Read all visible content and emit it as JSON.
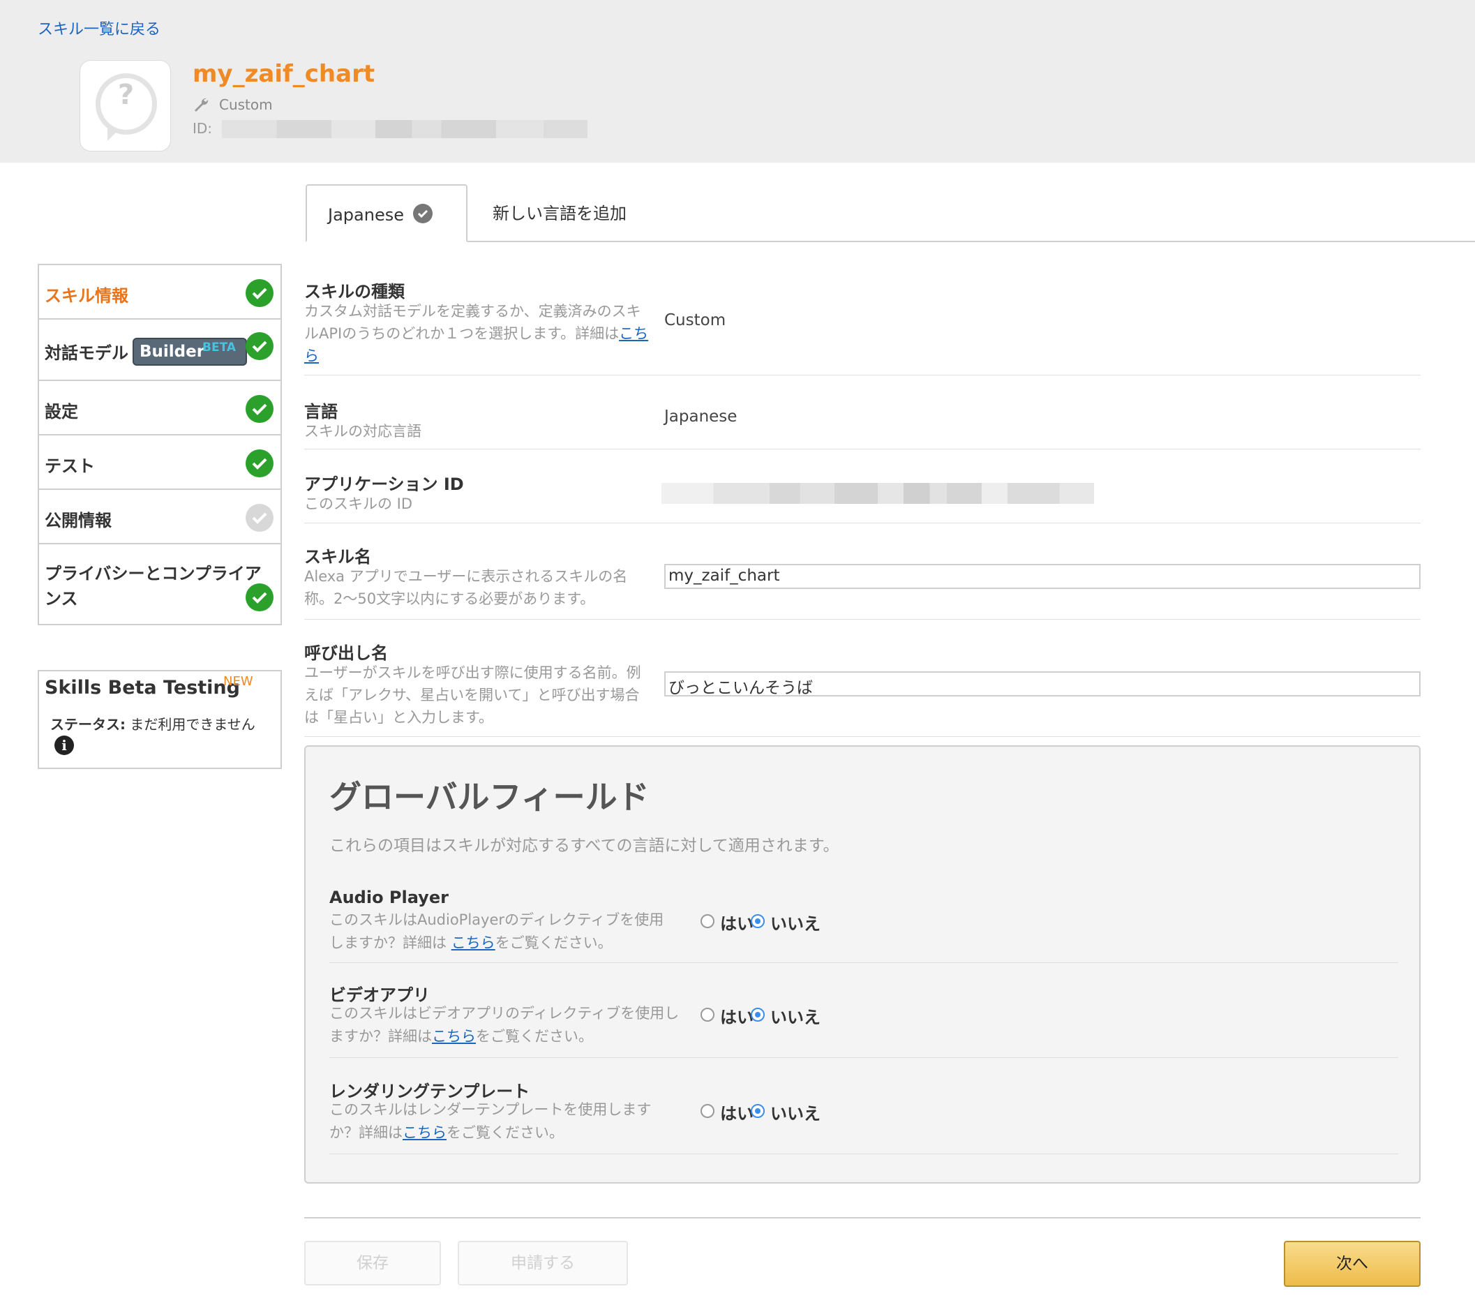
{
  "header": {
    "back_link": "スキル一覧に戻る",
    "skill_title": "my_zaif_chart",
    "skill_type": "Custom",
    "id_label": "ID:",
    "icon_glyph": "?"
  },
  "tabs": {
    "active_label": "Japanese",
    "add_label": "新しい言語を追加"
  },
  "sidebar": {
    "items": [
      {
        "label": "スキル情報",
        "status": "complete",
        "active": true
      },
      {
        "label": "対話モデル",
        "status": "complete",
        "badge": "Builder",
        "badge_sup": "BETA"
      },
      {
        "label": "設定",
        "status": "complete"
      },
      {
        "label": "テスト",
        "status": "complete"
      },
      {
        "label": "公開情報",
        "status": "incomplete"
      },
      {
        "label_line1": "プライバシーとコンプライア",
        "label_line2": "ンス",
        "status": "complete"
      }
    ],
    "beta_testing": {
      "title": "Skills Beta Testing",
      "new_badge": "NEW",
      "status_label": "ステータス:",
      "status_value": " まだ利用できません",
      "info_glyph": "i"
    }
  },
  "form": {
    "skill_type": {
      "title": "スキルの種類",
      "desc_part1": "カスタム対話モデルを定義するか、定義済みのスキルAPIのうちのどれか１つを選択します。詳細は",
      "desc_link": "こちら",
      "value": "Custom"
    },
    "language": {
      "title": "言語",
      "desc": "スキルの対応言語",
      "value": "Japanese"
    },
    "application_id": {
      "title": "アプリケーション ID",
      "desc": "このスキルの ID"
    },
    "skill_name": {
      "title": "スキル名",
      "desc": "Alexa アプリでユーザーに表示されるスキルの名称。2〜50文字以内にする必要があります。",
      "value": "my_zaif_chart"
    },
    "invocation_name": {
      "title": "呼び出し名",
      "desc": "ユーザーがスキルを呼び出す際に使用する名前。例えば「アレクサ、星占いを開いて」と呼び出す場合は「星占い」と入力します。",
      "value": "びっとこいんそうば"
    }
  },
  "global_fields": {
    "title": "グローバルフィールド",
    "desc": "これらの項目はスキルが対応するすべての言語に対して適用されます。",
    "yes_label": "はい",
    "no_label": "いいえ",
    "items": [
      {
        "title": "Audio Player",
        "desc_part1": "このスキルはAudioPlayerのディレクティブを使用しますか？詳細は ",
        "desc_link": "こちら",
        "desc_part2": "をご覧ください。",
        "selected": "いいえ"
      },
      {
        "title": "ビデオアプリ",
        "desc_part1": "このスキルはビデオアプリのディレクティブを使用しますか？詳細は",
        "desc_link": "こちら",
        "desc_part2": "をご覧ください。",
        "selected": "いいえ"
      },
      {
        "title": "レンダリングテンプレート",
        "desc_part1": "このスキルはレンダーテンプレートを使用しますか？詳細は",
        "desc_link": "こちら",
        "desc_part2": "をご覧ください。",
        "selected": "いいえ"
      }
    ]
  },
  "buttons": {
    "save": "保存",
    "submit": "申請する",
    "next": "次へ"
  },
  "colors": {
    "accent_orange": "#f08a24",
    "check_green": "#2ba12b",
    "link_blue": "#1a65c0",
    "radio_blue": "#3b8ee8"
  }
}
